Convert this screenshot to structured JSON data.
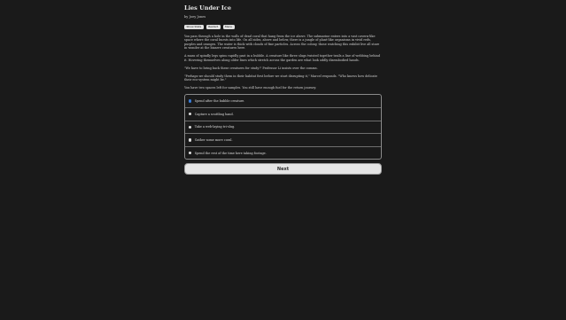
{
  "story": {
    "title": "Lies Under Ice",
    "author": "by Joey Jones",
    "toolbar": {
      "show_stats_label": "Show Stats",
      "restart_label": "Restart",
      "menu_label": "Menu"
    },
    "paragraphs": [
      "You pass through a hole in the walls of dead coral that hang from the ice above. The submarine enters into a vast cavern-like space where the coral bursts into life. On all sides, above and below, there is a jungle of plant-like organisms in vivid reds, purples and oranges. The water is thick with clouds of fine particles. Across the colony, those watching this exhibit live all stare in wonder at the bizarre creatures here.",
      "A mass of spindly legs spins rapidly past in a bubble. A creature like three slugs twisted together trails a line of webbing behind it. Hovering themselves along older lines which stretch across the garden are what look oddly disembodied hands.",
      "\"We have to bring back these creatures for study!\" Professor Li insists over the comms.",
      "\"Perhaps we should study them in their habitat first before we start disrupting it,\" Marcel responds. \"Who knows how delicate their eco-system might be.\"",
      "You have two spaces left for samples. You still have enough fuel for the return journey."
    ]
  },
  "choices": [
    {
      "label": "Spend after the bubble creature.",
      "selected": true
    },
    {
      "label": "Capture a scuttling hand.",
      "selected": false
    },
    {
      "label": "Take a web-laying tri-slug.",
      "selected": false
    },
    {
      "label": "Gather some more coral.",
      "selected": false
    },
    {
      "label": "Spend the rest of the time here taking footage.",
      "selected": false
    }
  ],
  "next_label": "Next",
  "colors": {
    "background": "#1a1a1a",
    "selected_radio": "#3a7bd5"
  }
}
